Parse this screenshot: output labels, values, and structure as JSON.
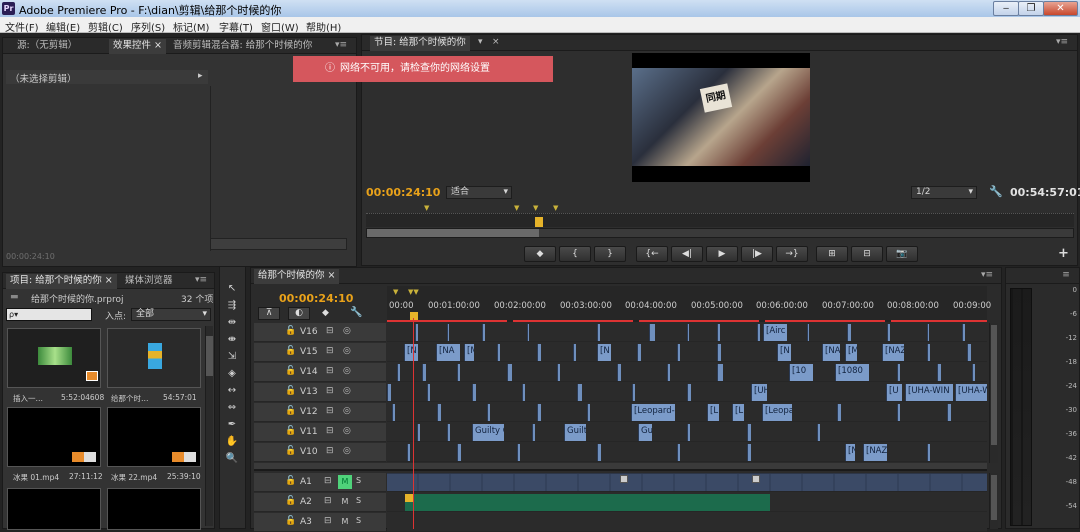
{
  "window": {
    "title": "Adobe Premiere Pro - F:\\dian\\剪辑\\给那个时候的你",
    "logo": "Pr",
    "min": "‒",
    "max": "❐",
    "close": "✕"
  },
  "menu": [
    "文件(F)",
    "编辑(E)",
    "剪辑(C)",
    "序列(S)",
    "标记(M)",
    "字幕(T)",
    "窗口(W)",
    "帮助(H)"
  ],
  "source_panel": {
    "tabs": [
      "源:（无剪辑）",
      "效果控件 ×",
      "音频剪辑混合器: 给那个时候的你"
    ],
    "no_selection": "（未选择剪辑）",
    "arrow": "▸",
    "timecode": "00:00:24:10"
  },
  "program_panel": {
    "tab": "节目: 给那个时候的你",
    "tab_dropdown": "▾",
    "tab_close": "×",
    "timecode": "00:00:24:10",
    "fit_label": "适合",
    "quality": "1/2",
    "duration": "00:54:57:01",
    "video_sign": "同期",
    "controls": [
      "◆",
      "{",
      "}",
      "{←",
      "◀|",
      "▶",
      "|▶",
      "→}",
      "⊞",
      "⊟",
      "📷"
    ],
    "add": "+"
  },
  "error_toast": {
    "icon": "ⓘ",
    "text": "网络不可用，请检查你的网络设置",
    "color": "#d5575d"
  },
  "project_panel": {
    "tabs": [
      "项目: 给那个时候的你 ×",
      "媒体浏览器"
    ],
    "project_file": "给那个时候的你.prproj",
    "item_count": "32 个项",
    "search_placeholder": "ρ▾",
    "in_point_label": "入点:",
    "in_point_value": "全部",
    "items": [
      {
        "name": "插入一…",
        "duration": "5:52:04608"
      },
      {
        "name": "给那个时…",
        "duration": "54:57:01"
      },
      {
        "name": "冰果 01.mp4",
        "duration": "27:11:12"
      },
      {
        "name": "冰果 22.mp4",
        "duration": "25:39:10"
      }
    ]
  },
  "timeline": {
    "tab": "给那个时候的你 ×",
    "timecode": "00:00:24:10",
    "ruler": [
      "00:00",
      "00:01:00:00",
      "00:02:00:00",
      "00:03:00:00",
      "00:04:00:00",
      "00:05:00:00",
      "00:06:00:00",
      "00:07:00:00",
      "00:08:00:00",
      "00:09:00"
    ],
    "video_tracks": [
      "V16",
      "V15",
      "V14",
      "V13",
      "V12",
      "V11",
      "V10"
    ],
    "audio_tracks": [
      "A1",
      "A2",
      "A3"
    ],
    "clip_labels": {
      "v16": [
        "[Airc"
      ],
      "v15": [
        "[N",
        "[NA",
        "[M",
        "[N",
        "[N",
        "[NA",
        "[M",
        "[NAZ"
      ],
      "v14": [
        "[10",
        "[1080"
      ],
      "v13": [
        "[UH",
        "[U",
        "[UHA-WIN",
        "[UHA-W"
      ],
      "v12": [
        "[Leopard-",
        "[L",
        "[L",
        "[Leopa"
      ],
      "v11": [
        "Guilty C",
        "Guilt",
        "Gu"
      ],
      "v10": [
        "[N",
        "[NAZ"
      ]
    },
    "mute_label": "M",
    "solo_label": "S"
  },
  "audio_meter": {
    "labels": [
      "0",
      "-6",
      "-12",
      "-18",
      "-24",
      "-30",
      "-36",
      "-42",
      "-48",
      "-54"
    ]
  }
}
